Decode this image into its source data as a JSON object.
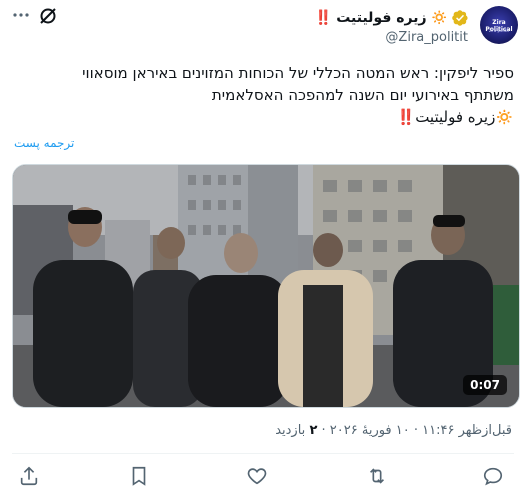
{
  "account": {
    "display_name": "زیره فولیتیت",
    "name_emoji_sun": "🔅",
    "name_emoji_mark": "‼️",
    "handle": "@Zira_politit",
    "avatar_text": "Zira Political",
    "avatar_subtext": "zira politit"
  },
  "tweet": {
    "line1": "ספיר ליפקין: ראש המטה הכללי של הכוחות המזוינים באיראן מוסאווי",
    "line2": "משתתף באירועי יום השנה למהפכה האסלאמית",
    "line3": "🔅زیره فولیتیت‼️",
    "translate_label": "ترجمه پست"
  },
  "video": {
    "duration": "0:07"
  },
  "meta": {
    "timestamp": "قبل‌ازظهر ۱۱:۴۶ · ۱۰ فوریهٔ ۲۰۲۶",
    "separator": " · ",
    "views_count": "۲",
    "views_label": "بازدید"
  },
  "icons": {
    "verified": "verified-badge-icon",
    "grok": "grok-icon",
    "more": "more-options-icon",
    "share": "share-icon",
    "bookmark": "bookmark-icon",
    "like": "heart-icon",
    "retweet": "retweet-icon",
    "reply": "reply-icon"
  },
  "colors": {
    "accent": "#1d9bf0",
    "text": "#0f1419",
    "secondary_text": "#536471",
    "verified_gold": "#e2b719"
  }
}
